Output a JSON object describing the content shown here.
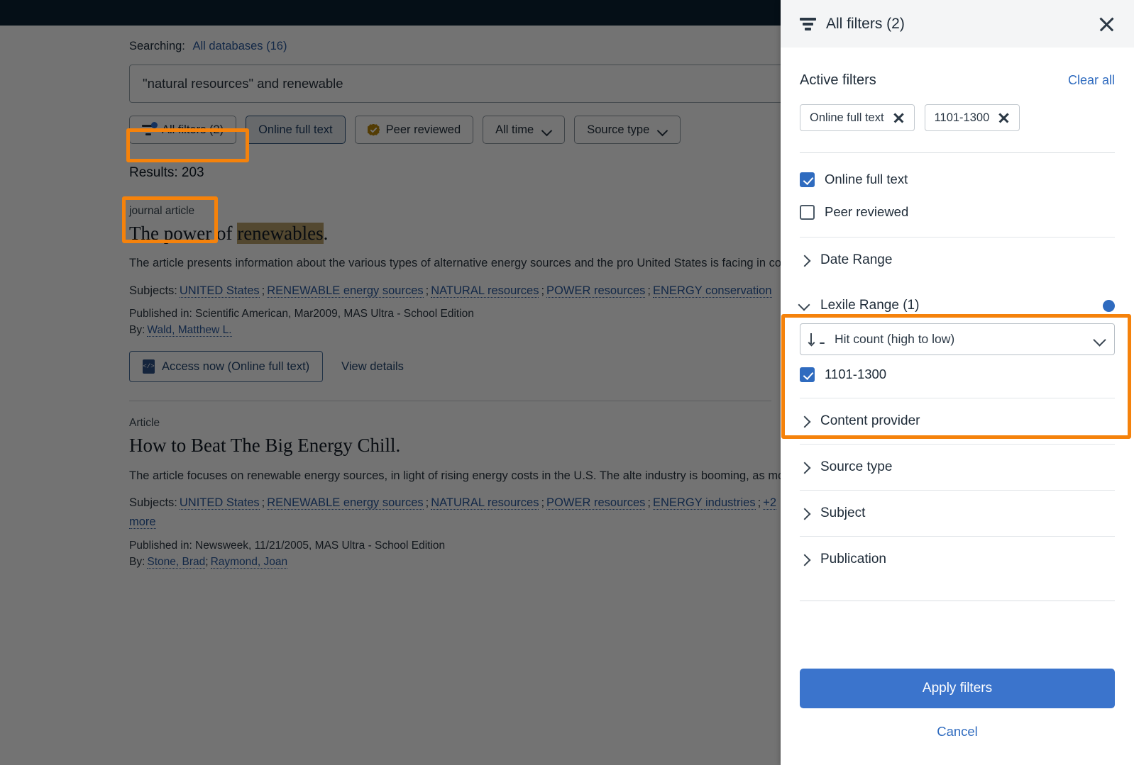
{
  "search": {
    "searching_label": "Searching:",
    "database_link": "All databases (16)",
    "query": "\"natural resources\" and renewable"
  },
  "filter_chips": [
    {
      "label": "All filters (2)",
      "icon": "filter-icon",
      "state": "default",
      "badge_dot": true
    },
    {
      "label": "Online full text",
      "icon": "",
      "state": "active"
    },
    {
      "label": "Peer reviewed",
      "icon": "verified-badge-icon",
      "state": "default"
    },
    {
      "label": "All time",
      "icon": "chevron-down-icon",
      "state": "default"
    },
    {
      "label": "Source type",
      "icon": "chevron-down-icon",
      "state": "default"
    }
  ],
  "results": {
    "count_label": "Results: 203",
    "items": [
      {
        "type": "journal article",
        "title_prefix": "The power of ",
        "title_highlight": "renewables",
        "title_suffix": ".",
        "abstract": "The article presents information about the various types of alternative energy sources and the pro United States is facing in collecting and distributing them. The author explains the motivations fo",
        "subjects_label": "Subjects:",
        "subjects": [
          "UNITED States",
          "RENEWABLE energy sources",
          "NATURAL resources",
          "POWER resources",
          "ENERGY conservation"
        ],
        "published_in": "Published in: Scientific American, Mar2009, MAS Ultra - School Edition",
        "by_label": "By:",
        "authors": [
          "Wald, Matthew L."
        ],
        "access_label": "Access now (Online full text)",
        "details_label": "View details"
      },
      {
        "type": "Article",
        "title_prefix": "How to Beat The Big Energy Chill.",
        "title_highlight": "",
        "title_suffix": "",
        "abstract": "The article focuses on renewable energy sources, in light of rising energy costs in the U.S. The alte industry is booming, as money floods into the industry. Silicon Valley engineers are starting renew",
        "subjects_label": "Subjects:",
        "subjects": [
          "UNITED States",
          "RENEWABLE energy sources",
          "NATURAL resources",
          "POWER resources",
          "ENERGY industries",
          "+2 more"
        ],
        "published_in": "Published in: Newsweek, 11/21/2005, MAS Ultra - School Edition",
        "by_label": "By:",
        "authors": [
          "Stone, Brad",
          "Raymond, Joan"
        ],
        "access_label": "",
        "details_label": ""
      }
    ]
  },
  "panel": {
    "title": "All filters (2)",
    "close_label": "close-panel",
    "active_filters_heading": "Active filters",
    "clear_all_label": "Clear all",
    "active_chips": [
      "Online full text",
      "1101-1300"
    ],
    "checkboxes": [
      {
        "label": "Online full text",
        "checked": true
      },
      {
        "label": "Peer reviewed",
        "checked": false
      }
    ],
    "accordions_before": [
      {
        "label": "Date Range",
        "expanded": false
      }
    ],
    "lexile": {
      "label": "Lexile Range (1)",
      "expanded": true,
      "has_indicator": true,
      "sort_value": "Hit count (high to low)",
      "options": [
        {
          "label": "1101-1300",
          "checked": true
        }
      ]
    },
    "accordions_after": [
      {
        "label": "Content provider",
        "expanded": false
      },
      {
        "label": "Source type",
        "expanded": false
      },
      {
        "label": "Subject",
        "expanded": false
      },
      {
        "label": "Publication",
        "expanded": false
      }
    ],
    "apply_label": "Apply filters",
    "cancel_label": "Cancel"
  },
  "colors": {
    "accent_blue": "#3b74cc",
    "link_blue": "#2f6bbf",
    "highlight_orange": "#f5820b",
    "topnav_navy": "#0d2233",
    "term_highlight": "#b9a06a"
  }
}
